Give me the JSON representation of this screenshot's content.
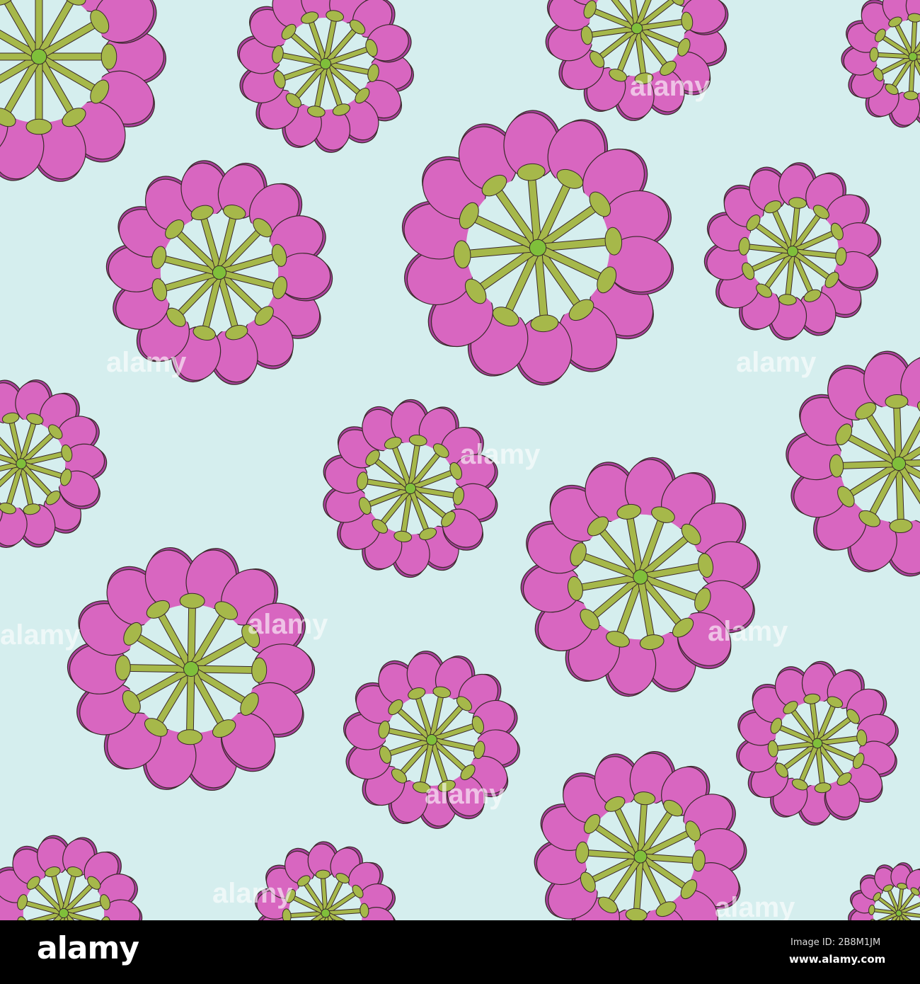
{
  "artwork": {
    "description_colors": {
      "background": "#d5eeee",
      "petal": "#d866c0",
      "petal_shadow": "#a8409a",
      "stem": "#a6b84a",
      "outline": "#3a2a2a"
    },
    "watermark": "alamy"
  },
  "footer": {
    "logo": "alamy",
    "image_id": "Image ID: 2B8M1JM",
    "url": "www.alamy.com"
  }
}
